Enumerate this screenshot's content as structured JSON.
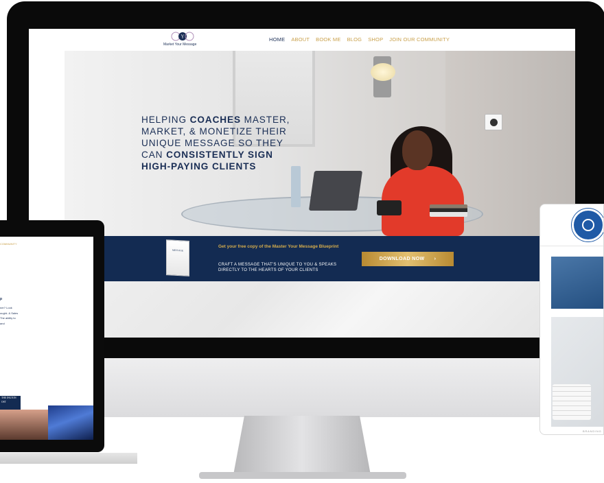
{
  "site": {
    "logo_text": "Market Your Message",
    "nav": [
      {
        "label": "HOME"
      },
      {
        "label": "ABOUT"
      },
      {
        "label": "BOOK ME"
      },
      {
        "label": "BLOG"
      },
      {
        "label": "SHOP"
      },
      {
        "label": "JOIN OUR COMMUNITY"
      }
    ],
    "hero": {
      "line1_pre": "HELPING ",
      "line1_bold": "COACHES",
      "line1_post": " MASTER, MARKET, & MONETIZE THEIR UNIQUE MESSAGE SO THEY CAN ",
      "line2_bold": "CONSISTENTLY SIGN HIGH-PAYING CLIENTS"
    },
    "blueprint": {
      "book_label": "MESSAGE",
      "title": "Get your free copy of the Master Your Message Blueprint",
      "subtitle": "CRAFT A MESSAGE THAT'S UNIQUE TO YOU & SPEAKS DIRECTLY TO THE HEARTS OF YOUR CLIENTS",
      "button_label": "DOWNLOAD NOW",
      "button_arrow": "›"
    }
  },
  "left_device": {
    "nav_fragment": "COMMUNITY",
    "heading_fragment": "p",
    "paragraph_fragment": "ner? Look ought- & Sales The ability to and",
    "press_fragment": "THE INGTON OST"
  },
  "right_device": {
    "caption": "BRANDING"
  },
  "colors": {
    "navy": "#132b52",
    "gold": "#c9a04a",
    "dress_red": "#e23a2a"
  }
}
